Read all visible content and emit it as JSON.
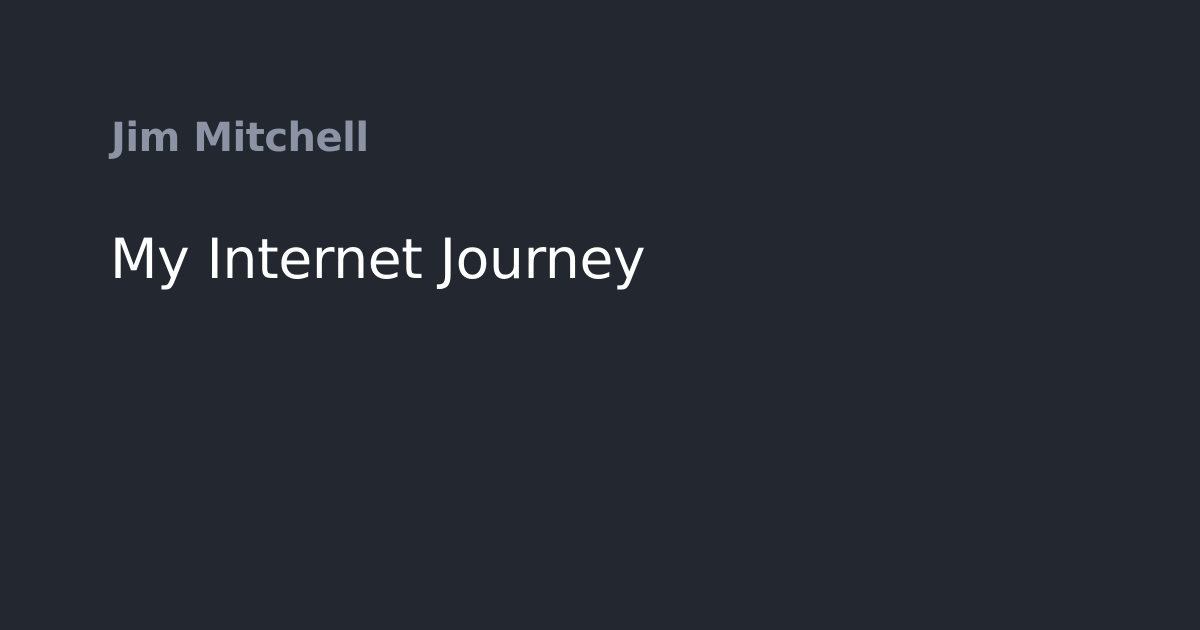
{
  "card": {
    "author": "Jim Mitchell",
    "title": "My Internet Journey"
  },
  "colors": {
    "background": "#23272f",
    "author_text": "#8b93a5",
    "title_text": "#ffffff"
  }
}
